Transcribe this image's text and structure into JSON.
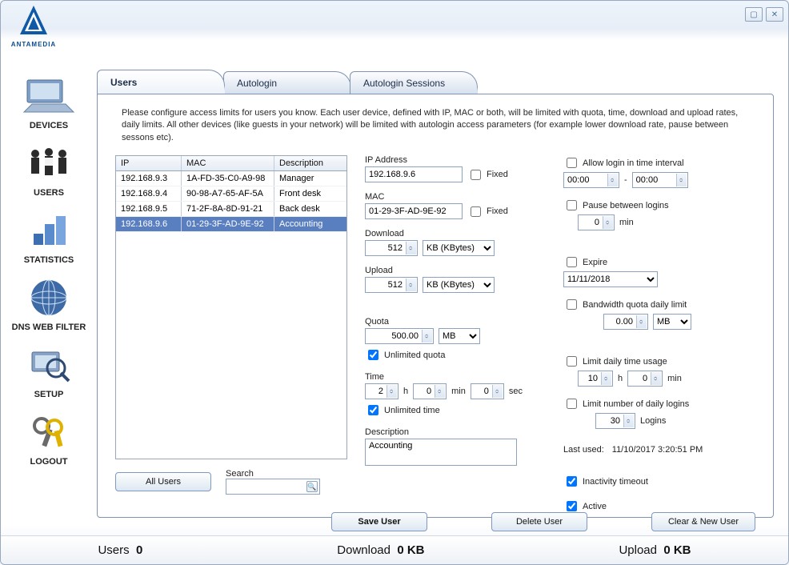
{
  "brand": "ANTAMEDIA",
  "window": {
    "min_tip": "⧉",
    "close_tip": "✕"
  },
  "sidebar": [
    {
      "label": "DEVICES",
      "name": "sidebar-item-devices"
    },
    {
      "label": "USERS",
      "name": "sidebar-item-users"
    },
    {
      "label": "STATISTICS",
      "name": "sidebar-item-statistics"
    },
    {
      "label": "DNS WEB FILTER",
      "name": "sidebar-item-dns-web-filter"
    },
    {
      "label": "SETUP",
      "name": "sidebar-item-setup"
    },
    {
      "label": "LOGOUT",
      "name": "sidebar-item-logout"
    }
  ],
  "tabs": {
    "users": "Users",
    "autologin": "Autologin",
    "sessions": "Autologin Sessions"
  },
  "help": "Please configure access limits for users you know. Each user device, defined with IP, MAC or both, will be limited with quota, time, download and upload rates, daily limits. All other devices (like guests in your network) will be limited with autologin access parameters (for example lower download rate, pause between sessons etc).",
  "table": {
    "headers": {
      "ip": "IP",
      "mac": "MAC",
      "desc": "Description"
    },
    "rows": [
      {
        "ip": "192.168.9.3",
        "mac": "1A-FD-35-C0-A9-98",
        "desc": "Manager"
      },
      {
        "ip": "192.168.9.4",
        "mac": "90-98-A7-65-AF-5A",
        "desc": "Front desk"
      },
      {
        "ip": "192.168.9.5",
        "mac": "71-2F-8A-8D-91-21",
        "desc": "Back desk"
      },
      {
        "ip": "192.168.9.6",
        "mac": "01-29-3F-AD-9E-92",
        "desc": "Accounting"
      }
    ],
    "selected_index": 3
  },
  "buttons": {
    "all_users": "All Users",
    "search_label": "Search",
    "save": "Save User",
    "delete": "Delete User",
    "clear": "Clear & New User"
  },
  "form": {
    "ip": {
      "label": "IP Address",
      "value": "192.168.9.6",
      "fixed_label": "Fixed"
    },
    "mac": {
      "label": "MAC",
      "value": "01-29-3F-AD-9E-92",
      "fixed_label": "Fixed"
    },
    "download": {
      "label": "Download",
      "value": "512",
      "unit": "KB (KBytes)"
    },
    "upload": {
      "label": "Upload",
      "value": "512",
      "unit": "KB (KBytes)"
    },
    "quota": {
      "label": "Quota",
      "value": "500.00",
      "unit": "MB",
      "unlimited_label": "Unlimited quota",
      "unlimited_checked": true
    },
    "time": {
      "label": "Time",
      "h": "2",
      "m": "0",
      "s": "0",
      "h_label": "h",
      "m_label": "min",
      "s_label": "sec",
      "unlimited_label": "Unlimited time",
      "unlimited_checked": true
    },
    "description": {
      "label": "Description",
      "value": "Accounting"
    },
    "allow_interval": {
      "label": "Allow login in time interval",
      "from": "00:00",
      "sep": "-",
      "to": "00:00",
      "checked": false
    },
    "pause": {
      "label": "Pause between logins",
      "value": "0",
      "unit": "min",
      "checked": false
    },
    "expire": {
      "label": "Expire",
      "value": "11/11/2018",
      "checked": false
    },
    "bw_daily": {
      "label": "Bandwidth quota daily limit",
      "value": "0.00",
      "unit": "MB",
      "checked": false
    },
    "daily_time": {
      "label": "Limit daily time usage",
      "h": "10",
      "h_label": "h",
      "m": "0",
      "m_label": "min",
      "checked": false
    },
    "daily_logins": {
      "label": "Limit number of daily logins",
      "value": "30",
      "unit": "Logins",
      "checked": false
    },
    "last_used": {
      "label": "Last used:",
      "value": "11/10/2017 3:20:51 PM"
    },
    "inactivity": {
      "label": "Inactivity timeout",
      "checked": true
    },
    "active": {
      "label": "Active",
      "checked": true
    }
  },
  "status": {
    "users_label": "Users",
    "users_val": "0",
    "dl_label": "Download",
    "dl_val": "0 KB",
    "ul_label": "Upload",
    "ul_val": "0 KB"
  }
}
